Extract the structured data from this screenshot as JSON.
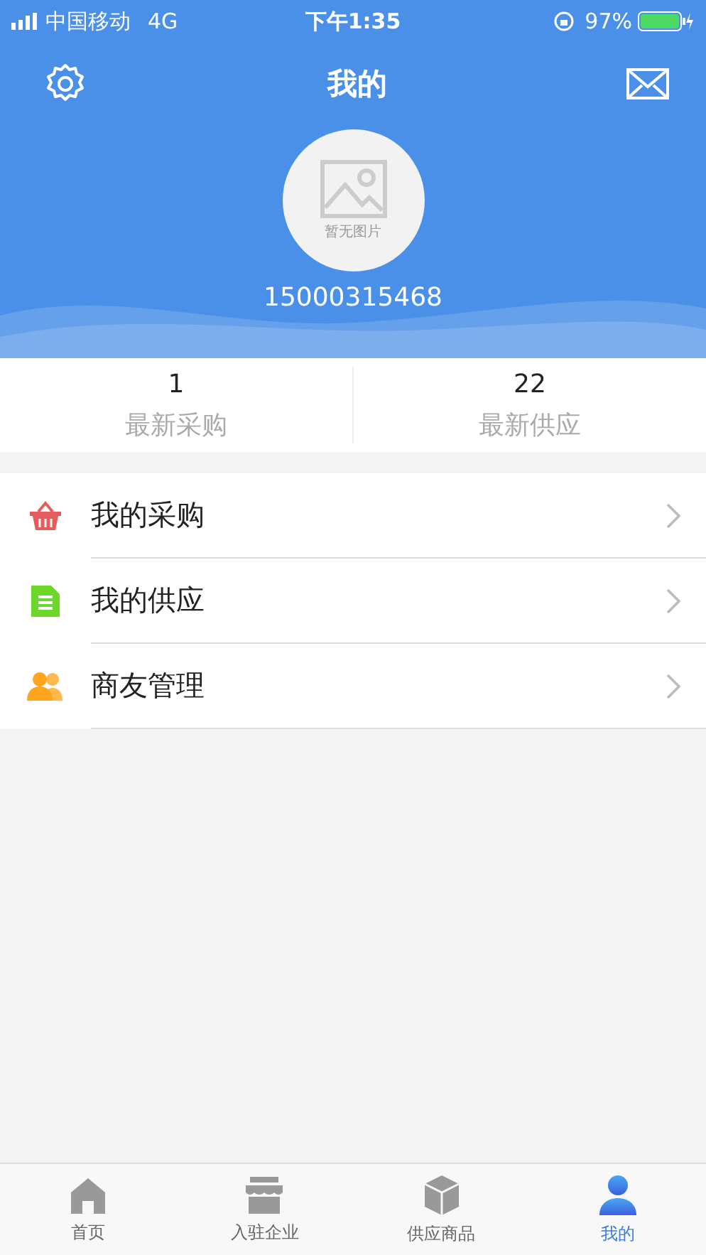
{
  "status_bar": {
    "carrier": "中国移动",
    "network": "4G",
    "time": "下午1:35",
    "battery": "97%"
  },
  "header": {
    "title": "我的",
    "avatar_text": "暂无图片",
    "phone": "15000315468"
  },
  "stats": [
    {
      "value": "1",
      "label": "最新采购"
    },
    {
      "value": "22",
      "label": "最新供应"
    }
  ],
  "menu": [
    {
      "kind": "basket",
      "label": "我的采购"
    },
    {
      "kind": "document",
      "label": "我的供应"
    },
    {
      "kind": "people",
      "label": "商友管理"
    }
  ],
  "tabs": [
    {
      "kind": "home",
      "label": "首页",
      "selected": false
    },
    {
      "kind": "store",
      "label": "入驻企业",
      "selected": false
    },
    {
      "kind": "box",
      "label": "供应商品",
      "selected": false
    },
    {
      "kind": "user",
      "label": "我的",
      "selected": true
    }
  ]
}
